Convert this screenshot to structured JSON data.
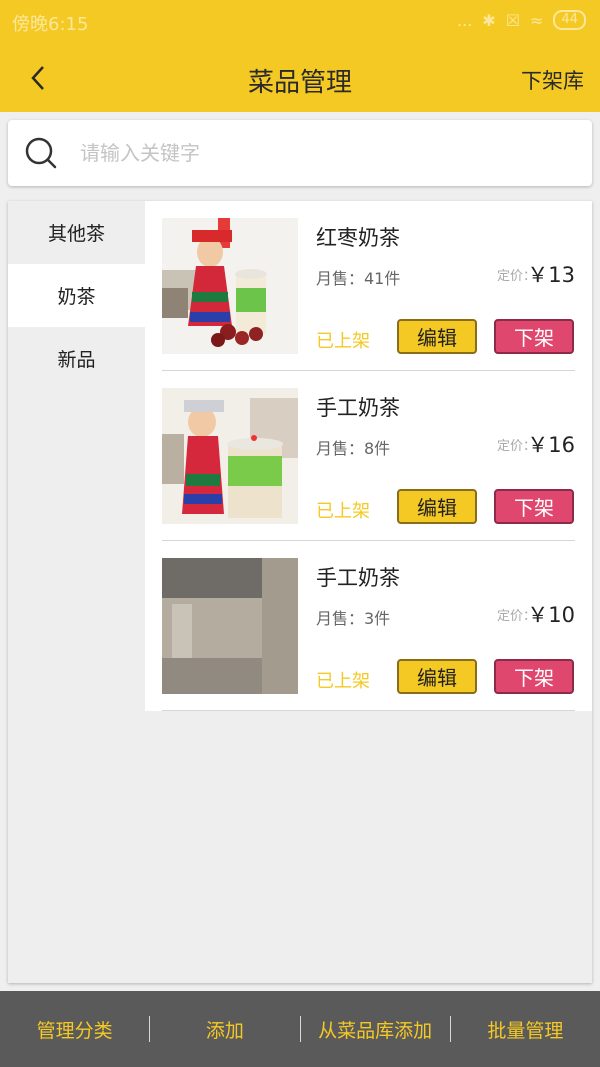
{
  "status_bar": {
    "time": "傍晚6:15",
    "signal": "...",
    "battery": "44"
  },
  "nav": {
    "title": "菜品管理",
    "right_action": "下架库"
  },
  "search": {
    "placeholder": "请输入关键字",
    "value": ""
  },
  "categories": [
    {
      "label": "其他茶",
      "active": false
    },
    {
      "label": "奶茶",
      "active": true
    },
    {
      "label": "新品",
      "active": false
    }
  ],
  "products": [
    {
      "name": "红枣奶茶",
      "sales": "月售：41件",
      "price_label": "定价：",
      "price": "￥13",
      "status": "已上架",
      "edit_label": "编辑",
      "off_label": "下架"
    },
    {
      "name": "手工奶茶",
      "sales": "月售：8件",
      "price_label": "定价：",
      "price": "￥16",
      "status": "已上架",
      "edit_label": "编辑",
      "off_label": "下架"
    },
    {
      "name": "手工奶茶",
      "sales": "月售：3件",
      "price_label": "定价：",
      "price": "￥10",
      "status": "已上架",
      "edit_label": "编辑",
      "off_label": "下架"
    }
  ],
  "bottom_bar": {
    "manage_categories": "管理分类",
    "add": "添加",
    "add_from_library": "从菜品库添加",
    "batch_manage": "批量管理"
  },
  "colors": {
    "accent": "#f5c924",
    "danger": "#e0476f",
    "bottom_bg": "#5a5a5a"
  }
}
